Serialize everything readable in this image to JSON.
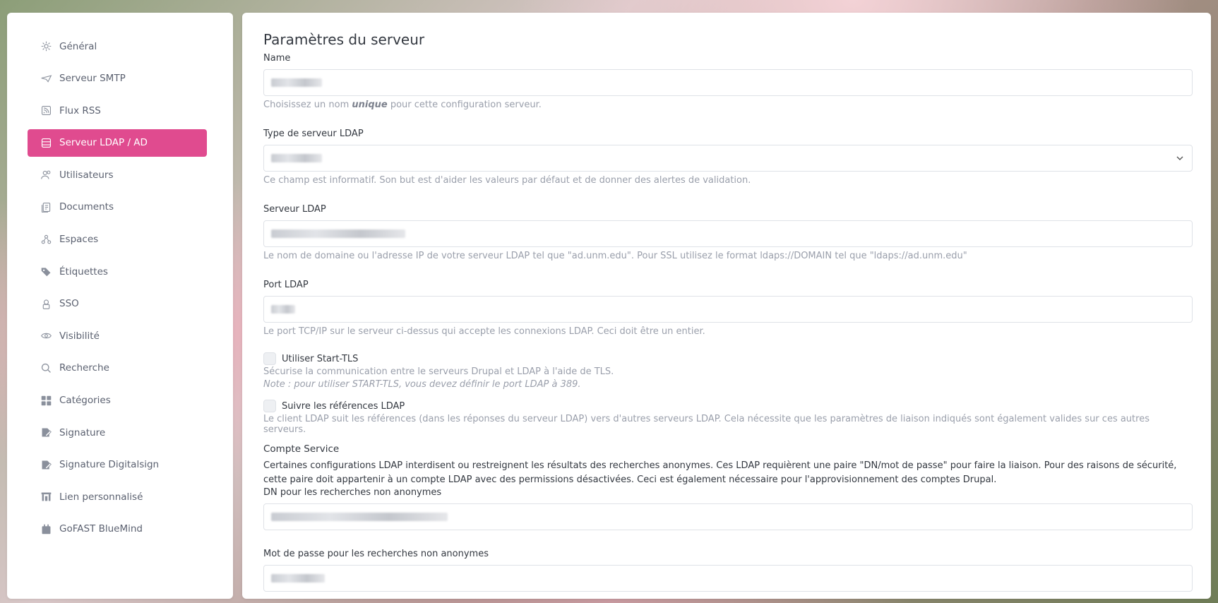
{
  "sidebar": {
    "items": [
      {
        "label": "Général",
        "icon": "gear-icon"
      },
      {
        "label": "Serveur SMTP",
        "icon": "send-icon"
      },
      {
        "label": "Flux RSS",
        "icon": "rss-icon"
      },
      {
        "label": "Serveur LDAP / AD",
        "icon": "server-icon",
        "active": true
      },
      {
        "label": "Utilisateurs",
        "icon": "users-icon"
      },
      {
        "label": "Documents",
        "icon": "documents-icon"
      },
      {
        "label": "Espaces",
        "icon": "spaces-icon"
      },
      {
        "label": "Étiquettes",
        "icon": "tags-icon"
      },
      {
        "label": "SSO",
        "icon": "sso-icon"
      },
      {
        "label": "Visibilité",
        "icon": "eye-icon"
      },
      {
        "label": "Recherche",
        "icon": "search-icon"
      },
      {
        "label": "Catégories",
        "icon": "grid-icon"
      },
      {
        "label": "Signature",
        "icon": "signature-icon"
      },
      {
        "label": "Signature Digitalsign",
        "icon": "signature-digital-icon"
      },
      {
        "label": "Lien personnalisé",
        "icon": "link-icon"
      },
      {
        "label": "GoFAST BlueMind",
        "icon": "calendar-icon"
      }
    ],
    "accent": "#e04b8f"
  },
  "main": {
    "title": "Paramètres du serveur",
    "name": {
      "label": "Name",
      "help_pre": "Choisissez un nom ",
      "help_em": "unique",
      "help_post": " pour cette configuration serveur."
    },
    "server_type": {
      "label": "Type de serveur LDAP",
      "help": "Ce champ est informatif. Son but est d'aider les valeurs par défaut et de donner des alertes de validation."
    },
    "server": {
      "label": "Serveur LDAP",
      "help": "Le nom de domaine ou l'adresse IP de votre serveur LDAP tel que \"ad.unm.edu\". Pour SSL utilisez le format ldaps://DOMAIN tel que \"ldaps://ad.unm.edu\""
    },
    "port": {
      "label": "Port LDAP",
      "help": "Le port TCP/IP sur le serveur ci-dessus qui accepte les connexions LDAP. Ceci doit être un entier."
    },
    "start_tls": {
      "label": "Utiliser Start-TLS",
      "help": "Sécurise la communication entre le serveurs Drupal et LDAP à l'aide de TLS.",
      "note": "Note : pour utiliser START-TLS, vous devez définir le port LDAP à 389."
    },
    "referrals": {
      "label": "Suivre les références LDAP",
      "help": "Le client LDAP suit les références (dans les réponses du serveur LDAP) vers d'autres serveurs LDAP. Cela nécessite que les paramètres de liaison indiqués sont également valides sur ces autres serveurs."
    },
    "service_account": {
      "heading": "Compte Service",
      "text": "Certaines configurations LDAP interdisent ou restreignent les résultats des recherches anonymes. Ces LDAP requièrent une paire \"DN/mot de passe\" pour faire la liaison. Pour des raisons de sécurité, cette paire doit appartenir à un compte LDAP avec des permissions désactivées. Ceci est également nécessaire pour l'approvisionnement des comptes Drupal.",
      "dn_label": "DN pour les recherches non anonymes"
    },
    "password": {
      "label": "Mot de passe pour les recherches non anonymes"
    }
  }
}
